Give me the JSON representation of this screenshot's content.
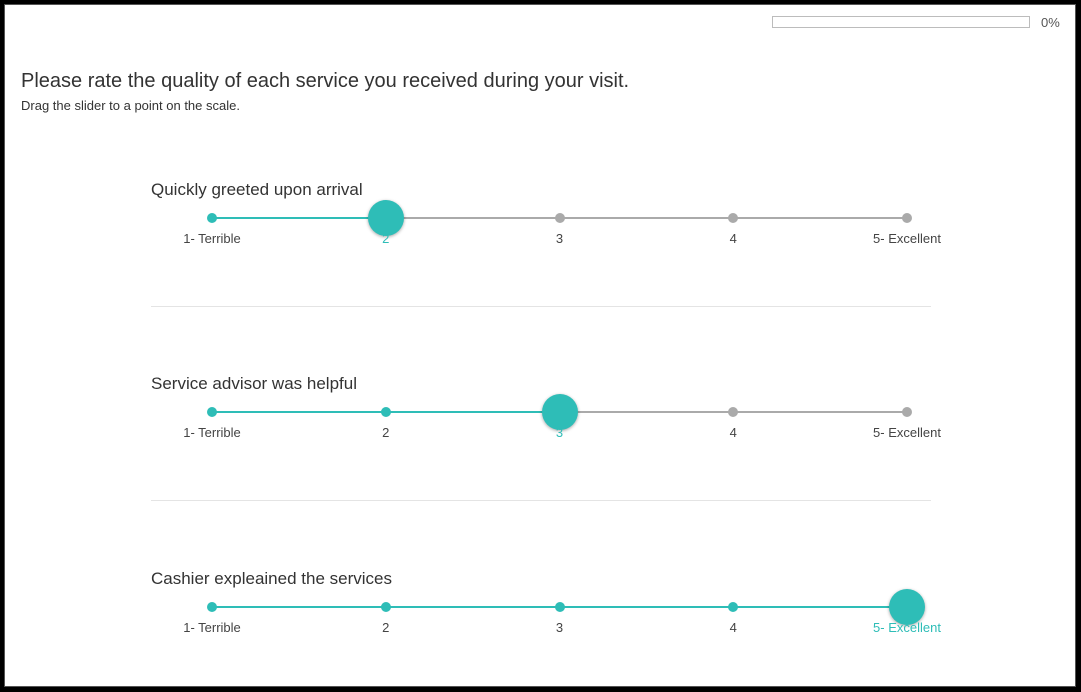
{
  "progress": {
    "value": 0,
    "label": "0%"
  },
  "question": {
    "title": "Please rate the quality of each service you received during your visit.",
    "instruction": "Drag the slider to a point on the scale."
  },
  "scale_labels": [
    "1- Terrible",
    "2",
    "3",
    "4",
    "5- Excellent"
  ],
  "sliders": [
    {
      "label": "Quickly greeted upon arrival",
      "value": 2
    },
    {
      "label": "Service advisor was helpful",
      "value": 3
    },
    {
      "label": "Cashier expleained the services",
      "value": 5
    }
  ],
  "colors": {
    "accent": "#2ebdb7",
    "track": "#aaaaaa"
  }
}
